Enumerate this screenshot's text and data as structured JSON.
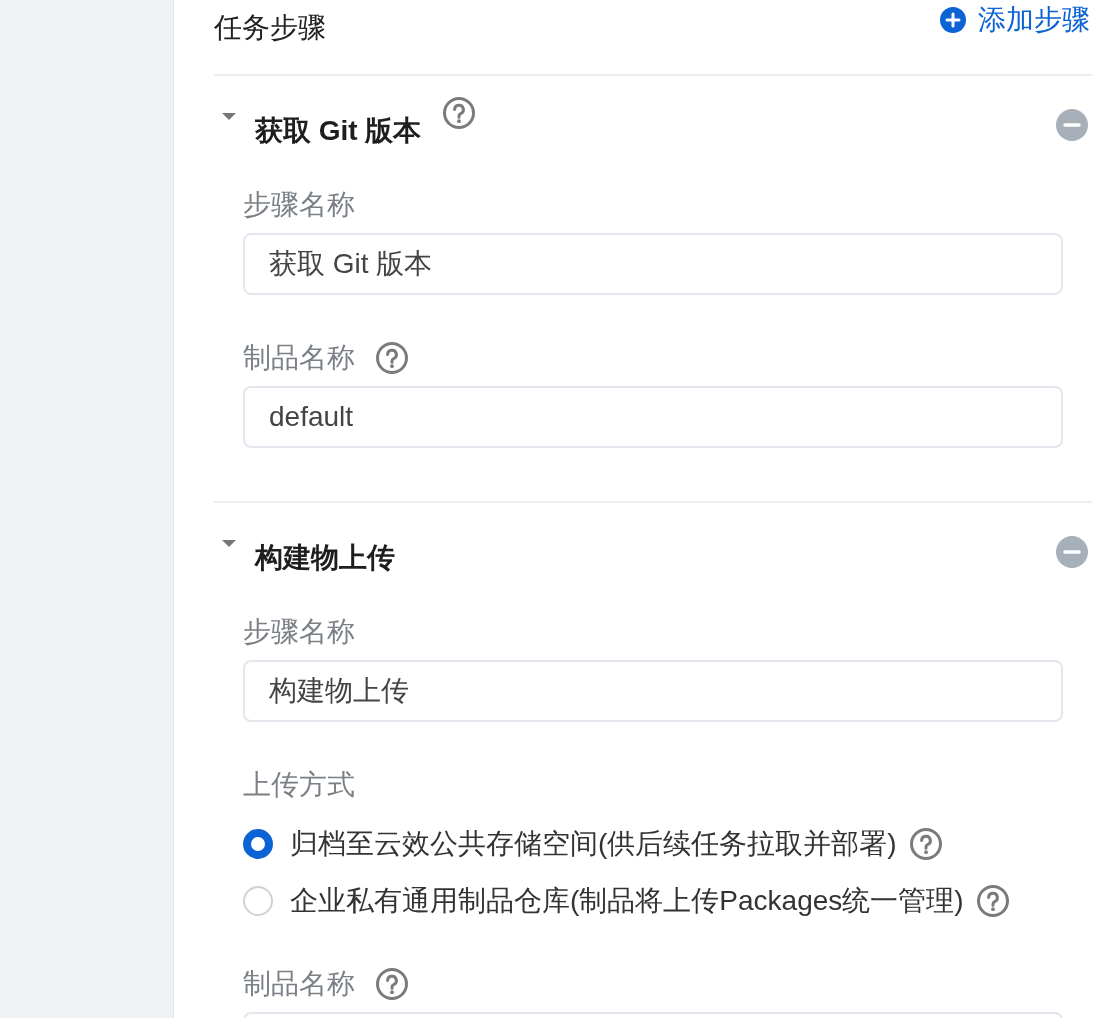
{
  "header": {
    "title": "任务步骤",
    "add_button": "添加步骤"
  },
  "steps": [
    {
      "title": "获取 Git 版本",
      "expanded": true,
      "title_help": true,
      "fields": [
        {
          "kind": "text",
          "label": "步骤名称",
          "help": false,
          "value": "获取 Git 版本"
        },
        {
          "kind": "text",
          "label": "制品名称",
          "help": true,
          "value": "default"
        }
      ]
    },
    {
      "title": "构建物上传",
      "expanded": true,
      "title_help": false,
      "fields": [
        {
          "kind": "text",
          "label": "步骤名称",
          "help": false,
          "value": "构建物上传"
        },
        {
          "kind": "radio",
          "label": "上传方式",
          "help": false,
          "options": [
            {
              "label": "归档至云效公共存储空间(供后续任务拉取并部署)",
              "help": true,
              "selected": true
            },
            {
              "label": "企业私有通用制品仓库(制品将上传Packages统一管理)",
              "help": true,
              "selected": false
            }
          ]
        },
        {
          "kind": "text",
          "label": "制品名称",
          "help": true
        }
      ]
    }
  ]
}
